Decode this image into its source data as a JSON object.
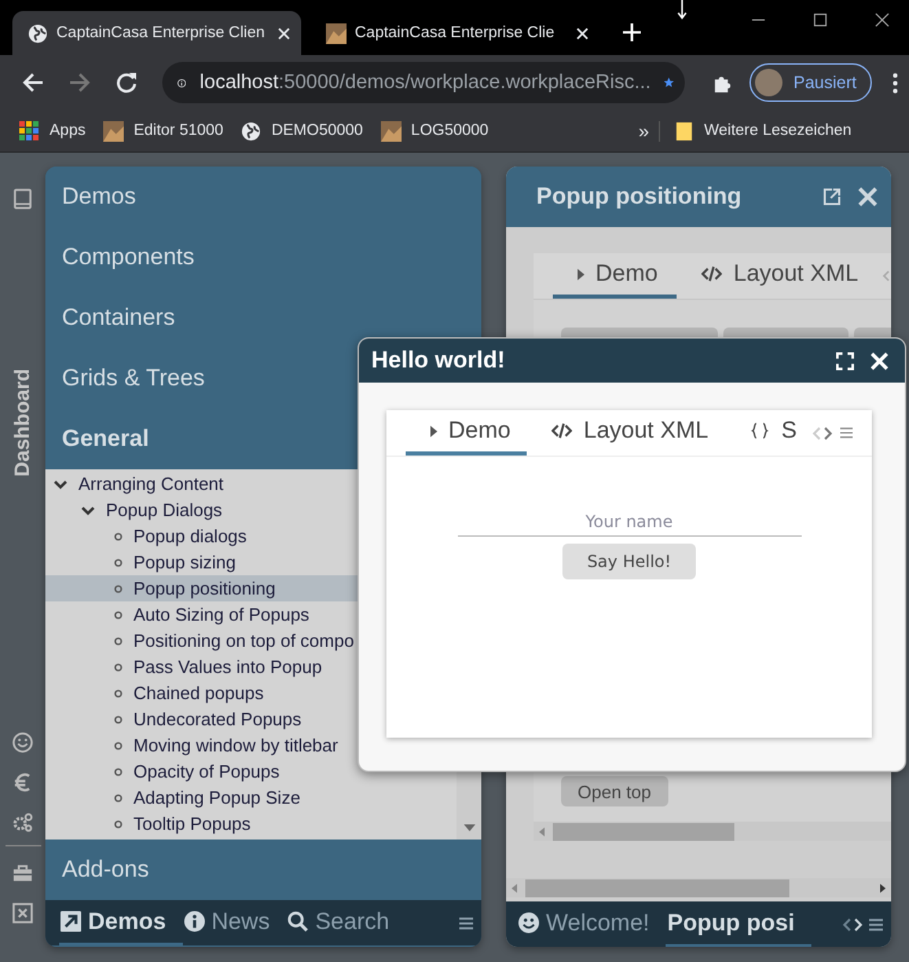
{
  "browser": {
    "tabs": [
      {
        "title": "CaptainCasa Enterprise Clien",
        "selected": true
      },
      {
        "title": "CaptainCasa Enterprise Clie",
        "selected": false
      }
    ],
    "address": {
      "host": "localhost",
      "path": ":50000/demos/workplace.workplaceRisc..."
    },
    "bookmarked": true,
    "profile": {
      "label": "Pausiert"
    },
    "bookmarks": [
      {
        "label": "Apps"
      },
      {
        "label": "Editor 51000"
      },
      {
        "label": "DEMO50000"
      },
      {
        "label": "LOG50000"
      }
    ],
    "overflow": "»",
    "other_bookmarks": "Weitere Lesezeichen"
  },
  "rail": {
    "label": "Dashboard"
  },
  "navigator": {
    "sections": [
      {
        "label": "Demos",
        "selected": false
      },
      {
        "label": "Components",
        "selected": false
      },
      {
        "label": "Containers",
        "selected": false
      },
      {
        "label": "Grids & Trees",
        "selected": false
      },
      {
        "label": "General",
        "selected": true
      }
    ],
    "tree": [
      {
        "label": "Arranging Content",
        "expanded": true,
        "children": [
          {
            "label": "Popup Dialogs",
            "expanded": true,
            "children": [
              {
                "label": "Popup dialogs",
                "selected": false
              },
              {
                "label": "Popup sizing",
                "selected": false
              },
              {
                "label": "Popup positioning",
                "selected": true
              },
              {
                "label": "Auto Sizing of Popups",
                "selected": false
              },
              {
                "label": "Positioning on top of compo",
                "selected": false
              },
              {
                "label": "Pass Values into Popup",
                "selected": false
              },
              {
                "label": "Chained popups",
                "selected": false
              },
              {
                "label": "Undecorated Popups",
                "selected": false
              },
              {
                "label": "Moving window by titlebar",
                "selected": false
              },
              {
                "label": "Opacity of Popups",
                "selected": false
              },
              {
                "label": "Adapting Popup Size",
                "selected": false
              },
              {
                "label": "Tooltip Popups",
                "selected": false
              }
            ]
          }
        ]
      }
    ],
    "footer_section": "Add-ons",
    "tabs": [
      {
        "label": "Demos",
        "selected": true
      },
      {
        "label": "News",
        "selected": false
      },
      {
        "label": "Search",
        "selected": false
      }
    ]
  },
  "workspace": {
    "title": "Popup positioning",
    "tabs": [
      {
        "label": "Demo",
        "selected": true
      },
      {
        "label": "Layout XML",
        "selected": false
      }
    ],
    "button": "Open top",
    "bottom_tabs": [
      {
        "label": "Welcome!",
        "selected": false
      },
      {
        "label": "Popup posi",
        "selected": true
      }
    ]
  },
  "popup": {
    "title": "Hello world!",
    "tabs": [
      {
        "label": "Demo",
        "selected": true
      },
      {
        "label": "Layout XML",
        "selected": false
      },
      {
        "label": "S",
        "selected": false
      }
    ],
    "field": {
      "placeholder": "Your name"
    },
    "button": "Say Hello!"
  }
}
